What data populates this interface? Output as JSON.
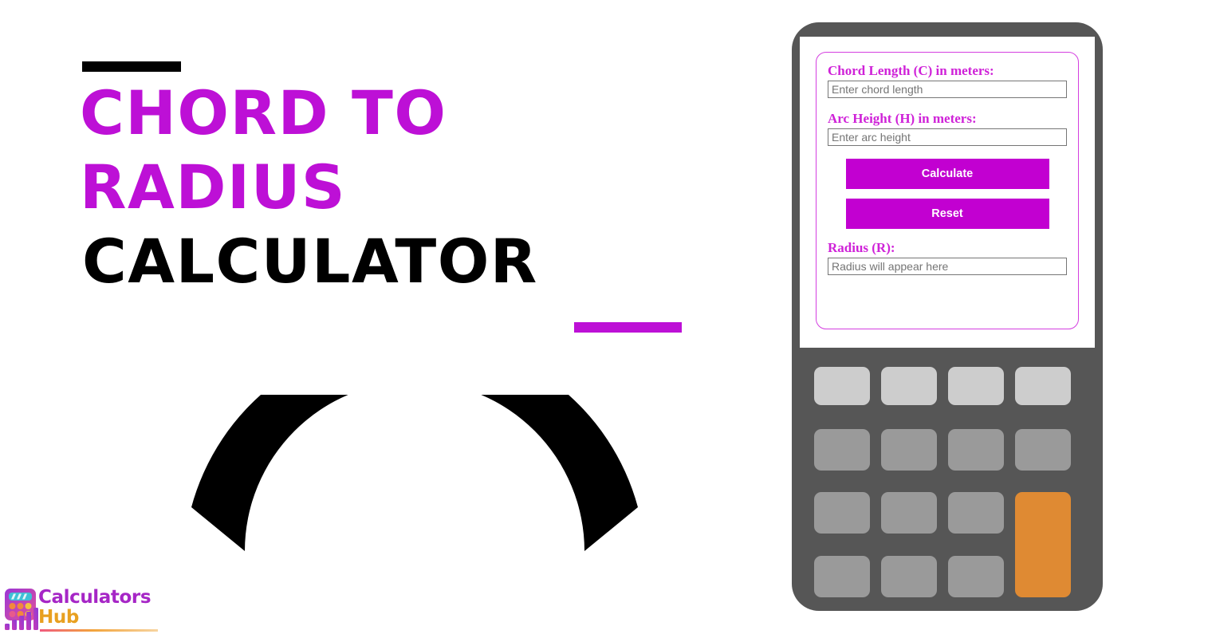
{
  "page": {
    "background_color": "#ffffff",
    "accent_magenta": "#bd10d6",
    "accent_black": "#000000"
  },
  "hero": {
    "top_rule": {
      "name": "top-rule",
      "color": "#000000"
    },
    "bottom_rule": {
      "name": "bottom-rule",
      "color": "#bd10d6"
    },
    "title_lines": [
      {
        "text": "CHORD TO",
        "color": "#bd10d6"
      },
      {
        "text": "RADIUS",
        "color": "#bd10d6"
      },
      {
        "text": "CALCULATOR",
        "color": "#000000"
      }
    ],
    "graphic": {
      "name": "arc-segment-illustration",
      "description": "thick black circular arc segment",
      "color": "#000000"
    }
  },
  "logo": {
    "icon_name": "calculators-hub-logo-icon",
    "line1": "Calculators",
    "line2": "Hub",
    "line1_color": "#a626c6",
    "line2_color": "#e8a020"
  },
  "calculator": {
    "frame_color": "#565656",
    "screen_background": "#ffffff",
    "form_border_color": "#d43fe0",
    "fields": [
      {
        "id": "chord-length",
        "label": "Chord Length (C) in meters:",
        "placeholder": "Enter chord length",
        "value": ""
      },
      {
        "id": "arc-height",
        "label": "Arc Height (H) in meters:",
        "placeholder": "Enter arc height",
        "value": ""
      }
    ],
    "buttons": {
      "calculate_label": "Calculate",
      "reset_label": "Reset",
      "button_color": "#c200d1",
      "button_text_color": "#ffffff"
    },
    "result": {
      "id": "radius",
      "label": "Radius (R):",
      "placeholder": "Radius will appear here",
      "value": ""
    },
    "keypad": {
      "rows": 4,
      "columns": 4,
      "light_key_color": "#cdcdcd",
      "gray_key_color": "#9a9a9a",
      "accent_key_color": "#df8a33",
      "keys": [
        {
          "name": "keypad-key-r1c1",
          "style": "light"
        },
        {
          "name": "keypad-key-r1c2",
          "style": "light"
        },
        {
          "name": "keypad-key-r1c3",
          "style": "light"
        },
        {
          "name": "keypad-key-r1c4",
          "style": "light"
        },
        {
          "name": "keypad-key-r2c1",
          "style": "gray"
        },
        {
          "name": "keypad-key-r2c2",
          "style": "gray"
        },
        {
          "name": "keypad-key-r2c3",
          "style": "gray"
        },
        {
          "name": "keypad-key-r2c4",
          "style": "gray"
        },
        {
          "name": "keypad-key-r3c1",
          "style": "gray"
        },
        {
          "name": "keypad-key-r3c2",
          "style": "gray"
        },
        {
          "name": "keypad-key-r3c3",
          "style": "gray"
        },
        {
          "name": "keypad-key-r4c1",
          "style": "gray"
        },
        {
          "name": "keypad-key-r4c2",
          "style": "gray"
        },
        {
          "name": "keypad-key-r4c3",
          "style": "gray"
        },
        {
          "name": "keypad-key-accent-tall",
          "style": "orange"
        }
      ]
    }
  }
}
